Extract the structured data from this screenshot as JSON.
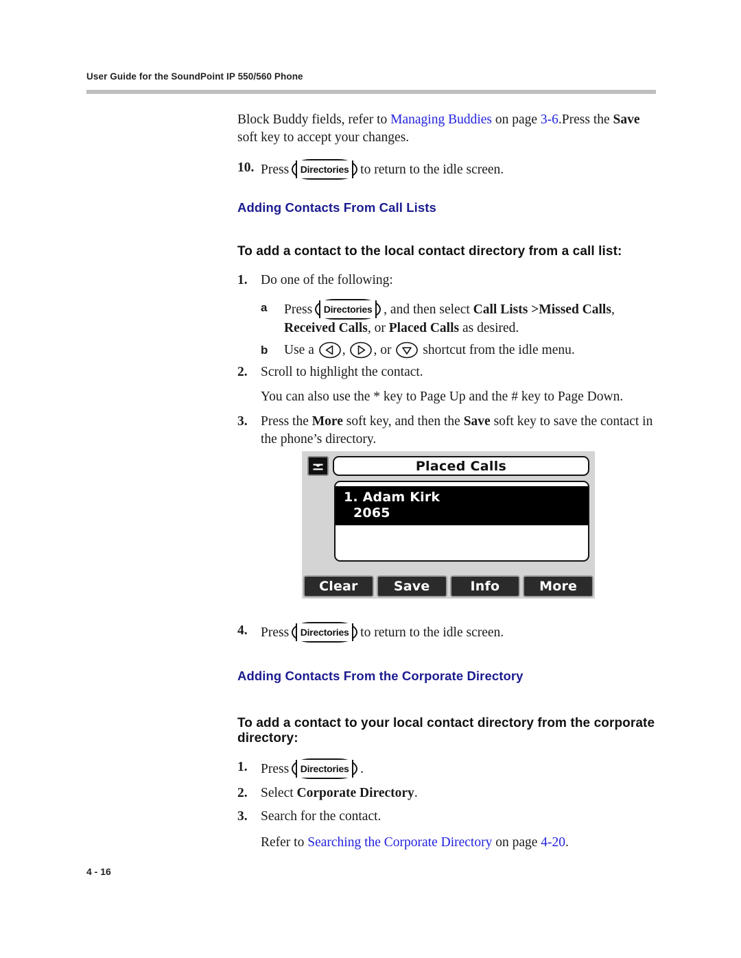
{
  "header": {
    "running_head": "User Guide for the SoundPoint IP 550/560 Phone"
  },
  "footer": {
    "page_number": "4 - 16"
  },
  "colors": {
    "heading_blue": "#1b1b8f",
    "link_blue": "#2222dd",
    "rule_gray": "#bfbfbf",
    "lcd_background": "#d4d4d4",
    "softkey_fill": "#2b2b2b"
  },
  "keycap": {
    "directories_label": "Directories"
  },
  "intro": {
    "line1_a": "Block Buddy fields, refer to ",
    "link": "Managing Buddies",
    "line1_b": " on page ",
    "page_ref": "3-6",
    "line1_c": ".Press the ",
    "bold_save": "Save",
    "line2": "soft key to accept your changes.",
    "step10_marker": "10.",
    "step10_pre": "Press",
    "step10_post": "to return to the idle screen."
  },
  "section_call_lists": {
    "heading": "Adding Contacts From Call Lists",
    "subheading": "To add a contact to the local contact directory from a call list:",
    "step1": {
      "marker": "1.",
      "text": "Do one of the following:"
    },
    "step1a": {
      "marker": "a",
      "pre": "Press",
      "mid": ", and then select ",
      "bold1": "Call Lists >Missed Calls",
      "after1": ", ",
      "bold2": "Received Calls",
      "after2": ", or ",
      "bold3": "Placed Calls",
      "after3": " as desired."
    },
    "step1b": {
      "marker": "b",
      "pre": "Use a ",
      "sep1": ", ",
      "sep2": ", or ",
      "post": " shortcut from the idle menu.",
      "icons": [
        "arrow-left-key-icon",
        "arrow-right-key-icon",
        "arrow-down-key-icon"
      ]
    },
    "step2": {
      "marker": "2.",
      "text": "Scroll to highlight the contact.",
      "note": "You can also use the * key to Page Up and the # key to Page Down."
    },
    "step3": {
      "marker": "3.",
      "pre": "Press the ",
      "bold1": "More",
      "mid": " soft key, and then the ",
      "bold2": "Save",
      "post": " soft key to save the contact in the phone’s directory."
    },
    "step4": {
      "marker": "4.",
      "pre": "Press",
      "post": "to return to the idle screen."
    }
  },
  "lcd_figure": {
    "phone_icon": "handset-icon",
    "title": "Placed Calls",
    "selected_entry": {
      "name": "1. Adam Kirk",
      "number": "2065"
    },
    "softkeys": [
      "Clear",
      "Save",
      "Info",
      "More"
    ]
  },
  "section_corporate": {
    "heading": "Adding Contacts From the Corporate Directory",
    "subheading": "To add a contact to your local contact directory from the corporate directory:",
    "step1": {
      "marker": "1.",
      "pre": "Press",
      "post": "."
    },
    "step2": {
      "marker": "2.",
      "pre": "Select ",
      "bold": "Corporate Directory",
      "post": "."
    },
    "step3": {
      "marker": "3.",
      "text": "Search for the contact.",
      "note_pre": "Refer to ",
      "note_link": "Searching the Corporate Directory",
      "note_mid": " on page ",
      "note_page": "4-20",
      "note_post": "."
    }
  }
}
